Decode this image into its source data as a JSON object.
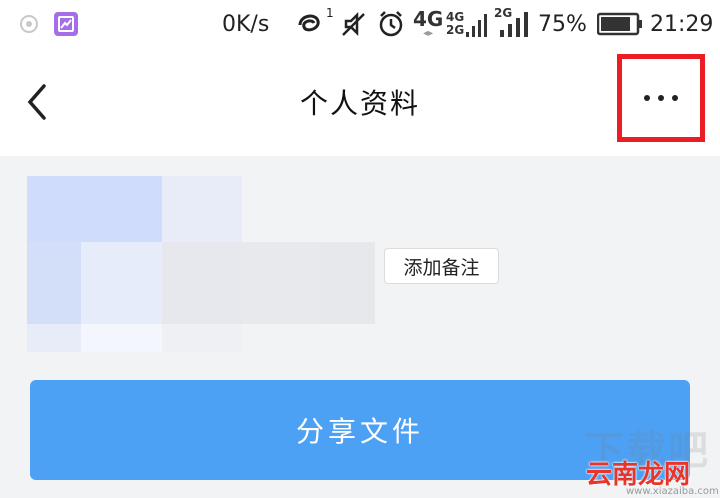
{
  "status_bar": {
    "net_speed": "0K/s",
    "hd_badge": "1",
    "net_4g": "4G",
    "sim1": "4G",
    "sim2": "2G",
    "sim3": "2G",
    "battery": "75%",
    "time": "21:29"
  },
  "nav": {
    "title": "个人资料"
  },
  "profile": {
    "add_remark_label": "添加备注"
  },
  "actions": {
    "share_label": "分享文件"
  },
  "watermark": {
    "big": "下载吧",
    "brand": "云南龙网",
    "url": "www.xiazaiba.com"
  },
  "colors": {
    "accent": "#4da1f5",
    "highlight": "#ec1c24"
  }
}
